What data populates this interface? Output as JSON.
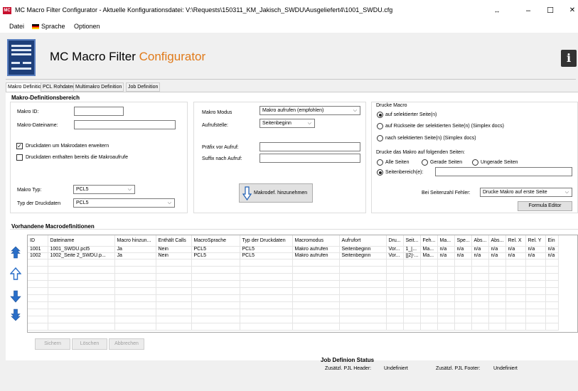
{
  "window": {
    "app_icon": "MC",
    "title": "MC Macro Filter Configurator - Aktuelle Konfigurationsdatei: V:\\Requests\\150311_KM_Jakisch_SWDU\\Ausgeliefert4\\1001_SWDU.cfg",
    "restore_glyph": "↔",
    "minimize_glyph": "–",
    "maximize_glyph": "☐",
    "close_glyph": "✕"
  },
  "menu": {
    "datei": "Datei",
    "sprache": "Sprache",
    "optionen": "Optionen"
  },
  "header": {
    "title_main": "MC Macro Filter ",
    "title_accent": "Configurator",
    "info_glyph": "i"
  },
  "tabs": [
    {
      "label": "Makro Definition"
    },
    {
      "label": "PCL Rohdaten"
    },
    {
      "label": "Multimakro Definition"
    },
    {
      "label": "Job Definition"
    }
  ],
  "makro_def": {
    "section_title": "Makro-Definitionsbereich",
    "makro_id_label": "Makro ID:",
    "makro_id_value": "",
    "dateiname_label": "Makro-Dateiname:",
    "dateiname_value": "",
    "check_erweitern_label": "Druckdaten um Makrodaten erweitern",
    "check_erweitern_mark": "✓",
    "check_enthalten_label": "Druckdaten enthalten bereits die Makroaufrufe",
    "makro_typ_label": "Makro Typ:",
    "makro_typ_value": "PCL5",
    "typ_druckdaten_label": "Typ der Druckdaten",
    "typ_druckdaten_value": "PCL5",
    "makro_modus_label": "Makro Modus",
    "makro_modus_value": "Makro aufrufen (empfohlen)",
    "aufrufstelle_label": "Aufrufstelle:",
    "aufrufstelle_value": "Seitenbeginn",
    "praefix_label": "Präfix vor Aufruf:",
    "praefix_value": "",
    "suffix_label": "Suffix nach Aufruf:",
    "suffix_value": "",
    "add_button": "Makrodef. hinzunehmen",
    "drucke_macro_title": "Drucke Macro",
    "radio_selektiert": "auf selektierter Seite(n)",
    "radio_rueckseite": "auf Rückseite der selektierten Seite(n) (Simplex docs)",
    "radio_nach": "nach selektierten Seite(n) (Simplex docs)",
    "folgende_seiten_title": "Drucke das Makro auf folgenden Seiten:",
    "radio_alle": "Alle Seiten",
    "radio_gerade": "Gerade Seiten",
    "radio_ungerade": "Ungerade Seiten",
    "radio_bereich": "Seitenbereich(e):",
    "seitenbereich_value": "",
    "seitenzahl_fehler_label": "Bei Seitenzahl Fehler:",
    "seitenzahl_fehler_value": "Drucke Makro auf erste Seite",
    "formula_editor": "Formula Editor"
  },
  "table": {
    "section_title": "Vorhandene Macrodefinitionen",
    "columns": [
      "ID",
      "Dateiname",
      "Macro hinzun...",
      "Enthält Calls",
      "MacroSprache",
      "Typ der Druckdaten",
      "Macromodus",
      "Aufrufort",
      "Dru...",
      "Seit...",
      "Feh...",
      "Ma...",
      "Spe...",
      "Abs...",
      "Abs...",
      "Rel. X",
      "Rel. Y",
      "Ein"
    ],
    "rows": [
      [
        "1001",
        "1001_SWDU.pcl5",
        "Ja",
        "Nein",
        "PCL5",
        "PCL5",
        "Makro aufrufen",
        "Seitenbeginn",
        "Vor...",
        "1_[...",
        "Ma...",
        "n/a",
        "n/a",
        "n/a",
        "n/a",
        "n/a",
        "n/a",
        "n/a"
      ],
      [
        "1002",
        "1002_Seite 2_SWDU.p...",
        "Ja",
        "Nein",
        "PCL5",
        "PCL5",
        "Makro aufrufen",
        "Seitenbeginn",
        "Vor...",
        "[[2]-...",
        "Ma...",
        "n/a",
        "n/a",
        "n/a",
        "n/a",
        "n/a",
        "n/a",
        "n/a"
      ]
    ]
  },
  "buttons": {
    "sichern": "Sichern",
    "loeschen": "Löschen",
    "abbrechen": "Abbrechen"
  },
  "status": {
    "title": "Job Definion Status",
    "pjl_header_label": "Zusätzl. PJL Header:",
    "pjl_header_value": "Undefiniert",
    "pjl_footer_label": "Zusätzl. PJL Footer:",
    "pjl_footer_value": "Undefiniert"
  },
  "colors": {
    "accent_orange": "#e07a1a",
    "arrow_blue": "#2a6fc9",
    "logo_blue": "#1e3f7a"
  }
}
